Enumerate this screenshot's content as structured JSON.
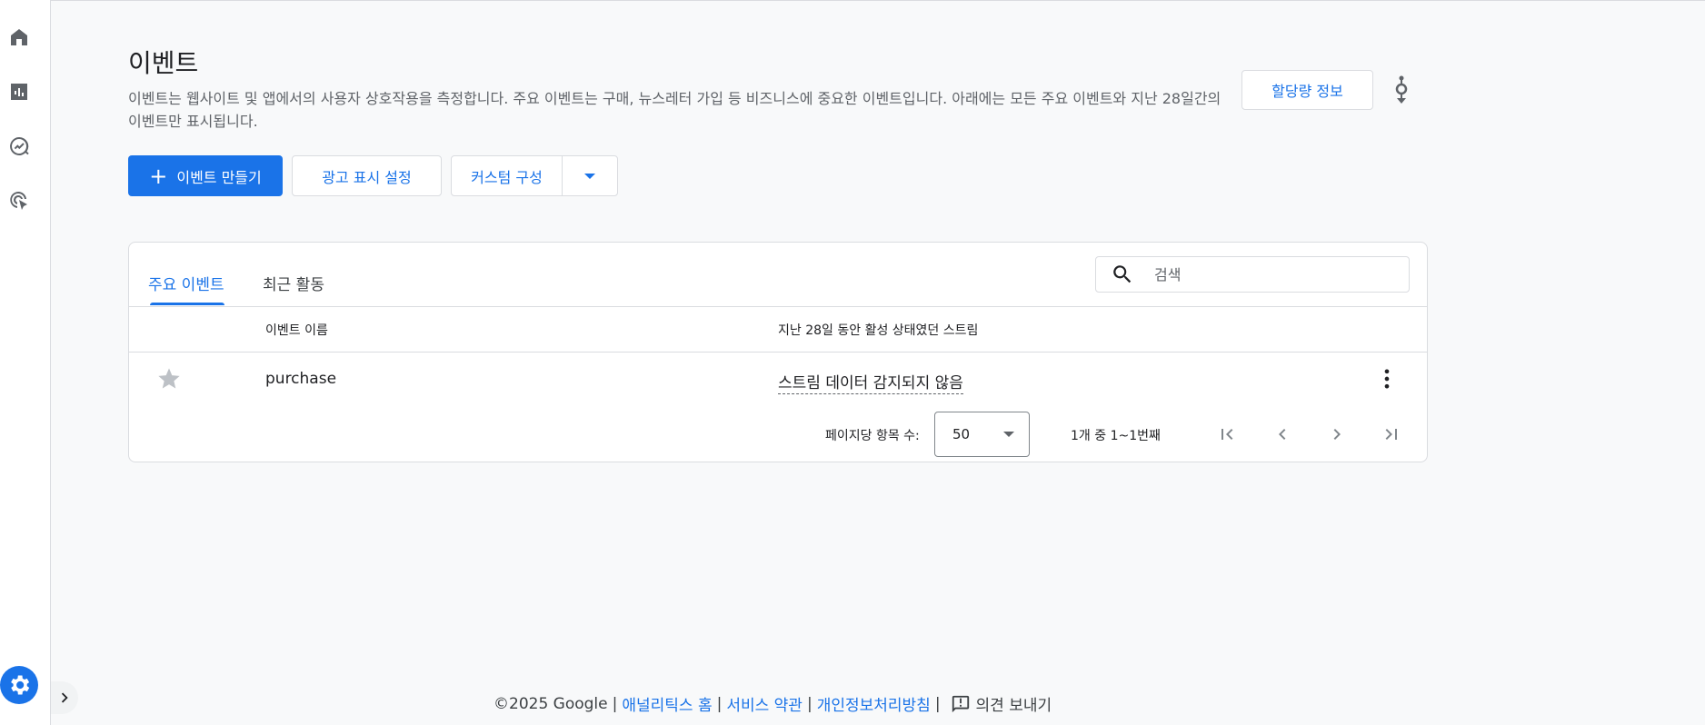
{
  "nav": {
    "items": [
      {
        "icon": "home-icon"
      },
      {
        "icon": "reports-icon"
      },
      {
        "icon": "explore-icon"
      },
      {
        "icon": "advertising-icon"
      }
    ],
    "settings_icon": "gear-icon",
    "expand_icon": "chevron-right-icon"
  },
  "header": {
    "title": "이벤트",
    "description": "이벤트는 웹사이트 및 앱에서의 사용자 상호작용을 측정합니다. 주요 이벤트는 구매, 뉴스레터 가입 등 비즈니스에 중요한 이벤트입니다. 아래에는 모든 주요 이벤트와 지난 28일간의 이벤트만 표시됩니다.",
    "quota_button": "할당량 정보",
    "debug_icon": "debugview-icon"
  },
  "actions": {
    "create_event": "이벤트 만들기",
    "ad_settings": "광고 표시 설정",
    "custom_config": "커스텀 구성"
  },
  "tabs": [
    {
      "label": "주요 이벤트",
      "active": true
    },
    {
      "label": "최근 활동",
      "active": false
    }
  ],
  "search": {
    "placeholder": "검색",
    "value": ""
  },
  "table": {
    "columns": [
      "이벤트 이름",
      "지난 28일 동안 활성 상태였던 스트림"
    ],
    "rows": [
      {
        "starred": false,
        "name": "purchase",
        "stream": "스트림 데이터 감지되지 않음"
      }
    ]
  },
  "pagination": {
    "per_page_label": "페이지당 항목 수:",
    "per_page_value": "50",
    "range": "1개 중 1~1번째"
  },
  "footer": {
    "copyright": "©2025 Google",
    "links": [
      "애널리틱스 홈",
      "서비스 약관",
      "개인정보처리방침"
    ],
    "feedback": "의견 보내기"
  },
  "colors": {
    "accent": "#1a73e8",
    "background": "#f8f9fa",
    "text": "#202124"
  }
}
